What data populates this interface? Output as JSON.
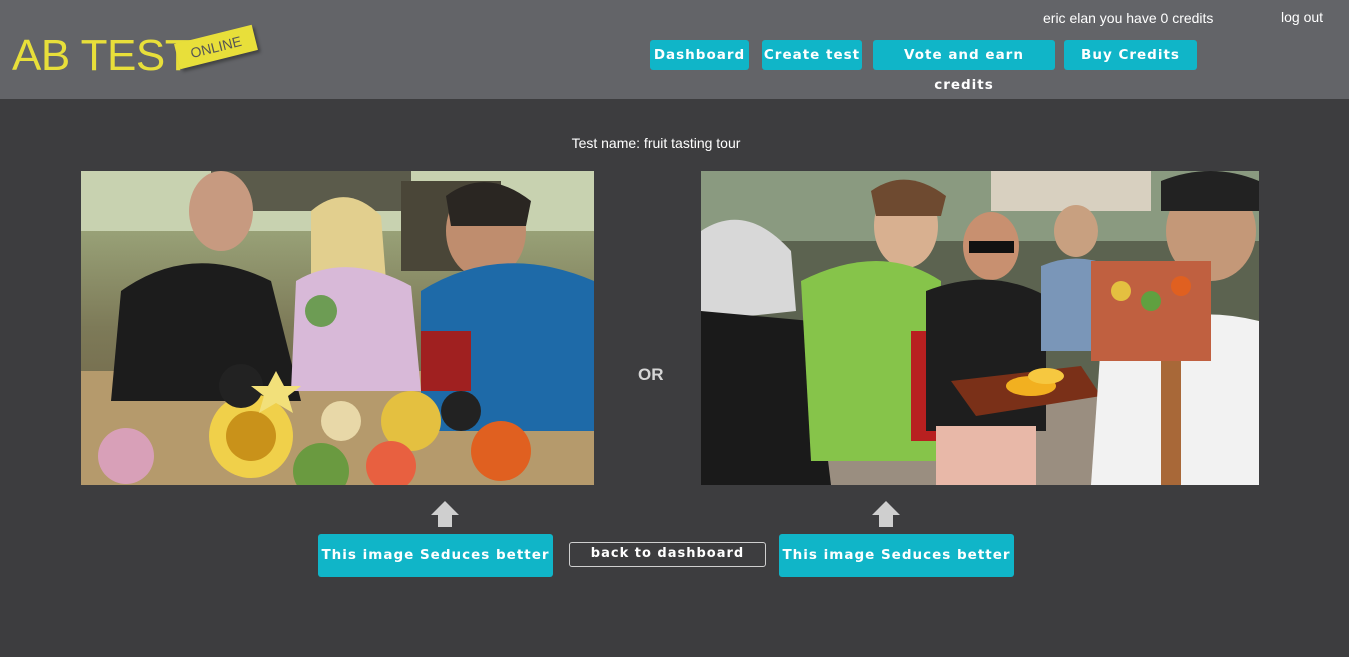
{
  "header": {
    "logo_text": "AB TEST",
    "logo_badge": "ONLINE",
    "credits_text": "eric elan you have 0 credits",
    "logout_label": "log out",
    "nav": [
      {
        "label": "Dashboard"
      },
      {
        "label": "Create test"
      },
      {
        "label": "Vote and earn credits"
      },
      {
        "label": "Buy Credits"
      }
    ]
  },
  "main": {
    "test_name": "Test name: fruit tasting tour",
    "or_label": "OR",
    "vote_left_label": "This image Seduces better",
    "vote_right_label": "This image Seduces better",
    "back_label": "back to dashboard",
    "arrow_icon": "arrow-up-icon"
  },
  "colors": {
    "header_bg": "#636468",
    "page_bg": "#3d3d3f",
    "accent": "#10b5c8",
    "logo": "#e8df3a"
  }
}
